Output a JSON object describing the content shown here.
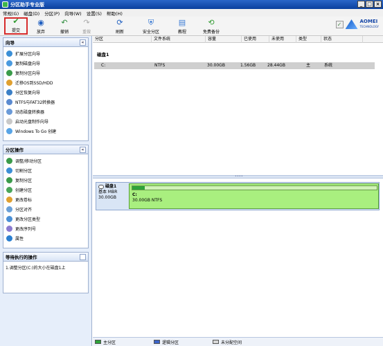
{
  "title": "分区助手专业版",
  "window_buttons": {
    "minimize": "_",
    "maximize": "□",
    "close": "×"
  },
  "menu": [
    "常规(G)",
    "磁盘(D)",
    "分区(P)",
    "向导(W)",
    "设置(S)",
    "帮助(H)"
  ],
  "toolbar": {
    "submit": "提交",
    "discard": "放弃",
    "undo": "撤销",
    "redo": "重做",
    "refresh": "刷新",
    "safe_partition": "安全分区",
    "tutorial": "教程",
    "free_backup": "免费备份"
  },
  "brand": {
    "name": "AOMEI",
    "sub": "TECHNOLOGY"
  },
  "wizard_panel": {
    "title": "向导",
    "collapse": "«",
    "items": [
      "扩展分区向导",
      "复制磁盘向导",
      "复制分区向导",
      "迁移OS到SSD/HDD",
      "分区恢复向导",
      "NTFS与FAT32转换器",
      "动态磁盘转换器",
      "启动光盘制作向导",
      "Windows To Go 创建"
    ]
  },
  "partition_ops_panel": {
    "title": "分区操作",
    "collapse": "«",
    "items": [
      "调整/移动分区",
      "切割分区",
      "复制分区",
      "创建分区",
      "更改卷标",
      "分区对齐",
      "更改分区类型",
      "更改序列号",
      "属性"
    ]
  },
  "pending_panel": {
    "title": "等待执行的操作",
    "items": [
      "1.调整分区(C:)的大小在磁盘1上"
    ]
  },
  "table": {
    "headers": [
      "分区",
      "文件系统",
      "容量",
      "已使用",
      "未使用",
      "类型",
      "状态"
    ],
    "disk_label": "磁盘1",
    "rows": [
      {
        "partition": "C:",
        "fs": "NTFS",
        "capacity": "30.00GB",
        "used": "1.56GB",
        "free": "28.44GB",
        "type": "主",
        "status": "系统"
      }
    ]
  },
  "disk_map": {
    "name": "磁盘1",
    "type": "基本 MBR",
    "size": "30.00GB",
    "partition_label": "C:",
    "partition_desc": "30.00GB NTFS",
    "used_fraction": 0.052
  },
  "legend": [
    "主分区",
    "逻辑分区",
    "未分配空间"
  ],
  "colors": {
    "primary": "#2ea33a",
    "logical": "#3b63c9",
    "unallocated": "#d8d8d8",
    "partition_fill": "#a9ef7f"
  }
}
